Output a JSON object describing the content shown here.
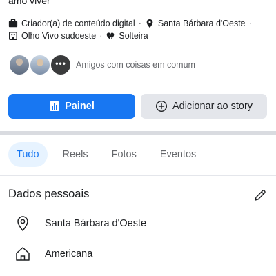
{
  "profile": {
    "bio_tail": "amo viver",
    "info_line1": [
      {
        "icon": "briefcase-icon",
        "text": "Criador(a) de conteúdo digital"
      },
      {
        "icon": "location-pin-icon",
        "text": "Santa Bárbara d'Oeste"
      }
    ],
    "info_line2": [
      {
        "icon": "building-icon",
        "text": "Olho Vivo sudoeste"
      },
      {
        "icon": "broken-heart-icon",
        "text": "Solteira"
      }
    ],
    "separator": "·",
    "friends": {
      "more_indicator": "•••",
      "label": "Amigos com coisas em comum"
    }
  },
  "actions": {
    "painel_label": "Painel",
    "story_label": "Adicionar ao story"
  },
  "tabs": [
    {
      "label": "Tudo",
      "active": true
    },
    {
      "label": "Reels",
      "active": false
    },
    {
      "label": "Fotos",
      "active": false
    },
    {
      "label": "Eventos",
      "active": false
    }
  ],
  "personal": {
    "title": "Dados pessoais",
    "items": [
      {
        "icon": "location-pin-icon",
        "text": "Santa Bárbara d'Oeste"
      },
      {
        "icon": "home-icon",
        "text": "Americana"
      }
    ]
  },
  "colors": {
    "accent": "#1877f2",
    "secondary_button": "#e4e6eb",
    "active_tab_bg": "#e7f3ff",
    "muted_text": "#65676b"
  }
}
